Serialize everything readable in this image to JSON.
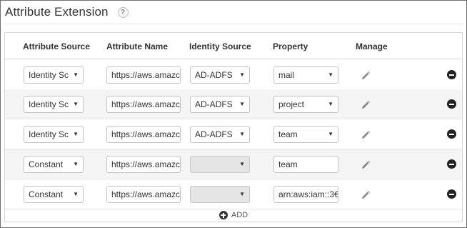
{
  "title": "Attribute Extension",
  "help_glyph": "?",
  "columns": {
    "attribute_source": "Attribute Source",
    "attribute_name": "Attribute Name",
    "identity_source": "Identity Source",
    "property": "Property",
    "manage": "Manage"
  },
  "rows": [
    {
      "attribute_source": "Identity Sc",
      "attribute_name": "https://aws.amazc",
      "identity_source": "AD-ADFS",
      "property": "mail",
      "property_is_select": true
    },
    {
      "attribute_source": "Identity Sc",
      "attribute_name": "https://aws.amazc",
      "identity_source": "AD-ADFS",
      "property": "project",
      "property_is_select": true
    },
    {
      "attribute_source": "Identity Sc",
      "attribute_name": "https://aws.amazc",
      "identity_source": "AD-ADFS",
      "property": "team",
      "property_is_select": true
    },
    {
      "attribute_source": "Constant",
      "attribute_name": "https://aws.amazc",
      "identity_source": "",
      "property": "team",
      "property_is_select": false
    },
    {
      "attribute_source": "Constant",
      "attribute_name": "https://aws.amazc",
      "identity_source": "",
      "property": "arn:aws:iam::3€",
      "property_is_select": false
    }
  ],
  "add_label": "ADD",
  "icons": {
    "caret": "caret-down-icon",
    "manage": "pencil-icon",
    "remove": "minus-circle-icon",
    "add": "plus-circle-icon"
  },
  "colors": {
    "row_alt": "#f5f5f5",
    "border": "#c4c4c4",
    "disabled": "#e5e5e5",
    "icon_dark": "#222222"
  }
}
